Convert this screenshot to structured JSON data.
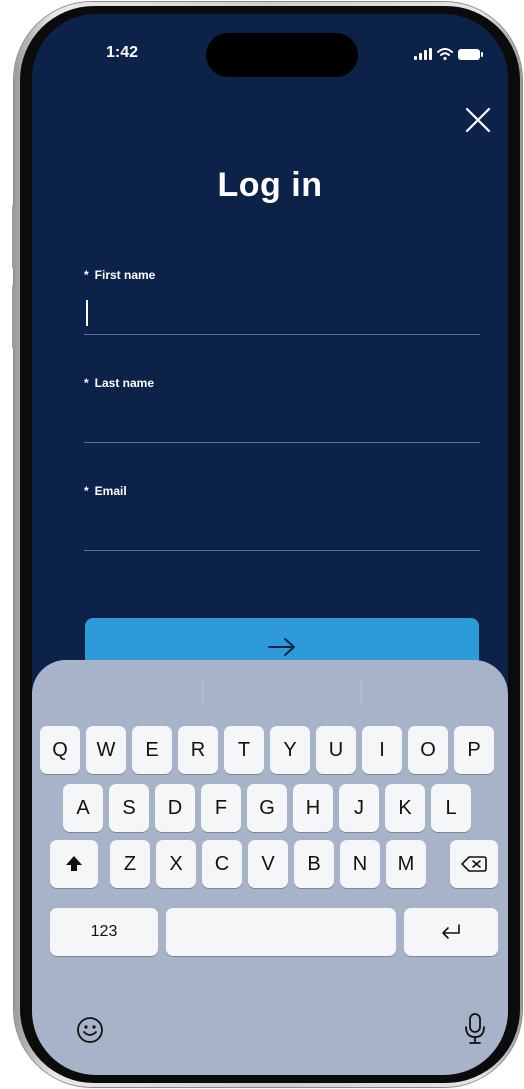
{
  "status_bar": {
    "time": "1:42"
  },
  "form": {
    "title": "Log in",
    "fields": [
      {
        "required_marker": "*",
        "label": "First name",
        "value": "",
        "placeholder": ""
      },
      {
        "required_marker": "*",
        "label": "Last name",
        "value": "",
        "placeholder": ""
      },
      {
        "required_marker": "*",
        "label": "Email",
        "value": "",
        "placeholder": ""
      }
    ],
    "submit_icon": "arrow-right-icon",
    "close_icon": "close-icon"
  },
  "keyboard": {
    "row1": [
      "Q",
      "W",
      "E",
      "R",
      "T",
      "Y",
      "U",
      "I",
      "O",
      "P"
    ],
    "row2": [
      "A",
      "S",
      "D",
      "F",
      "G",
      "H",
      "J",
      "K",
      "L"
    ],
    "row3": [
      "Z",
      "X",
      "C",
      "V",
      "B",
      "N",
      "M"
    ],
    "numbers_label": "123",
    "icons": {
      "shift": "shift-icon",
      "backspace": "backspace-icon",
      "return": "return-icon",
      "emoji": "emoji-icon",
      "mic": "microphone-icon"
    }
  },
  "colors": {
    "background": "#0c2249",
    "accent": "#2d9bd9",
    "keyboard": "#a7b3c8",
    "key": "#f5f6f8"
  }
}
